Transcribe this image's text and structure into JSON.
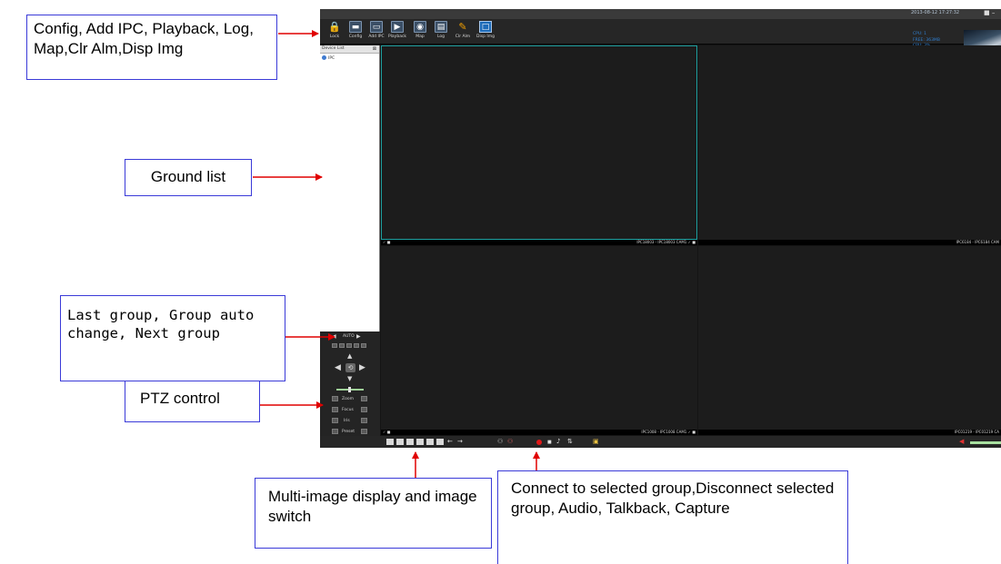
{
  "window": {
    "clock": "2013-08-12 17:27:32",
    "win_controls": "■ –"
  },
  "toolbar": {
    "items": [
      {
        "label": "Lock",
        "icon": "lock-icon"
      },
      {
        "label": "Config",
        "icon": "config-icon"
      },
      {
        "label": "Add IPC",
        "icon": "add-ipc-icon"
      },
      {
        "label": "Playback",
        "icon": "playback-icon"
      },
      {
        "label": "Map",
        "icon": "map-icon"
      },
      {
        "label": "Log",
        "icon": "log-icon"
      },
      {
        "label": "Clr Alm",
        "icon": "clear-alarm-icon"
      },
      {
        "label": "Disp Img",
        "icon": "display-image-icon"
      }
    ],
    "stats": [
      "CPU: 1",
      "FREE: 363MB",
      "CPU: 3%"
    ]
  },
  "device_list": {
    "header": "Device List",
    "close": "⊠",
    "tree_root": "IPC"
  },
  "group_nav": {
    "auto": "AUTO"
  },
  "ptz": {
    "presets": [
      "1",
      "2",
      "3",
      "4"
    ],
    "zoom": "Zoom",
    "focus": "Focus",
    "iris": "Iris",
    "preset": "Preset"
  },
  "video": {
    "cells": [
      {
        "left_label": "✓ ■",
        "right_label": "IPC18003 - IPC18003 CAM1 ✓ ■"
      },
      {
        "left_label": "",
        "right_label": "IPC6184 - IPC6184 CAM"
      },
      {
        "left_label": "✓ ■",
        "right_label": "IPC1008 - IPC1008 CAM1 ✓ ■"
      },
      {
        "left_label": "",
        "right_label": "IPC01219 - IPC01219 CA"
      }
    ]
  },
  "bottombar": {
    "prev": "←",
    "next": "→",
    "audio": "♪",
    "talk": "⇅",
    "capture": "▣"
  },
  "callouts": {
    "toolbar": "Config, Add IPC, Playback, Log, Map,Clr Alm,Disp Img",
    "ground_list": "Ground list",
    "group": "Last group, Group auto change, Next group",
    "ptz": "PTZ control",
    "multi_image": "Multi-image display and image switch",
    "connect": "Connect to selected group,Disconnect selected group, Audio, Talkback, Capture"
  },
  "colors": {
    "callout_border": "#3a3ad8",
    "arrow": "#e00000",
    "selected_cell": "#1ea0a0",
    "record": "#e01818"
  }
}
